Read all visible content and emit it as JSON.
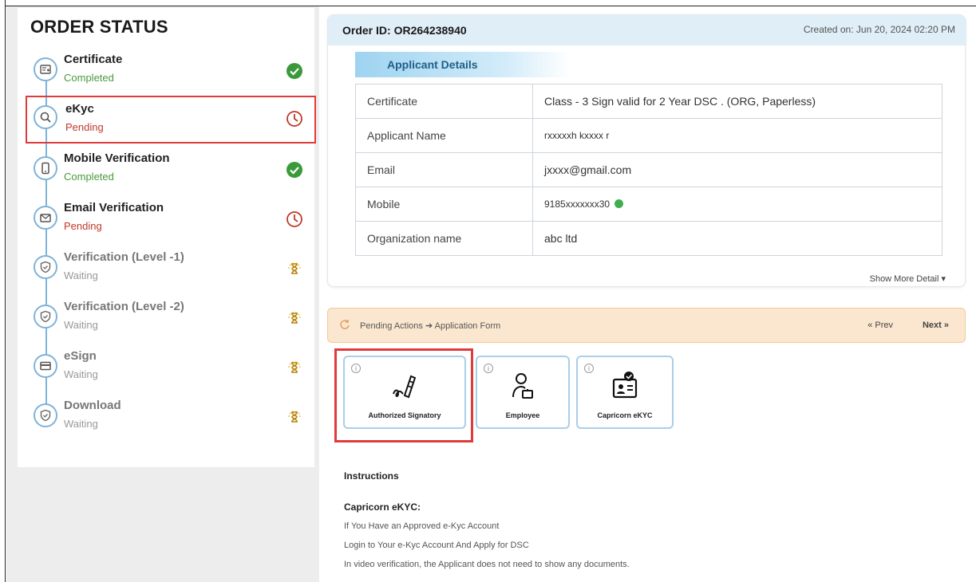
{
  "sidebar": {
    "title": "ORDER STATUS",
    "steps": [
      {
        "title": "Certificate",
        "status": "Completed",
        "state": "completed",
        "icon": "certificate-icon"
      },
      {
        "title": "eKyc",
        "status": "Pending",
        "state": "pending",
        "icon": "search-icon"
      },
      {
        "title": "Mobile Verification",
        "status": "Completed",
        "state": "completed",
        "icon": "mobile-icon"
      },
      {
        "title": "Email Verification",
        "status": "Pending",
        "state": "pending",
        "icon": "mail-icon"
      },
      {
        "title": "Verification (Level -1)",
        "status": "Waiting",
        "state": "waiting",
        "icon": "shield-icon"
      },
      {
        "title": "Verification (Level -2)",
        "status": "Waiting",
        "state": "waiting",
        "icon": "shield-icon"
      },
      {
        "title": "eSign",
        "status": "Waiting",
        "state": "waiting",
        "icon": "card-icon"
      },
      {
        "title": "Download",
        "status": "Waiting",
        "state": "waiting",
        "icon": "shield-icon"
      }
    ]
  },
  "order": {
    "id_label": "Order ID: OR264238940",
    "created_on": "Created on: Jun 20, 2024 02:20 PM",
    "details_tab": "Applicant Details",
    "details": [
      {
        "key": "Certificate",
        "value": "Class - 3 Sign valid for 2 Year DSC . (ORG, Paperless)"
      },
      {
        "key": "Applicant Name",
        "value": "rxxxxxh kxxxx r"
      },
      {
        "key": "Email",
        "value": "jxxxx@gmail.com"
      },
      {
        "key": "Mobile",
        "value": "9185xxxxxxx30"
      },
      {
        "key": "Organization name",
        "value": "abc ltd"
      }
    ],
    "show_more": "Show More Detail ▾"
  },
  "pending": {
    "text": "Pending Actions ➔ Application Form",
    "prev": "« Prev",
    "next": "Next »"
  },
  "options": [
    {
      "label": "Authorized Signatory",
      "icon": "signature-icon"
    },
    {
      "label": "Employee",
      "icon": "employee-icon"
    },
    {
      "label": "Capricorn eKYC",
      "icon": "id-card-icon"
    }
  ],
  "instructions": {
    "heading": "Instructions",
    "subheading": "Capricorn eKYC:",
    "lines": [
      "If You Have an Approved e-Kyc Account",
      "Login to Your e-Kyc Account And Apply for DSC",
      "In video verification, the Applicant does not need to show any documents."
    ]
  },
  "colors": {
    "completed": "#3a9a3a",
    "pending": "#c0392b",
    "waiting": "#d4a017",
    "accent": "#7fb3d9",
    "highlight": "#e03a3a"
  }
}
